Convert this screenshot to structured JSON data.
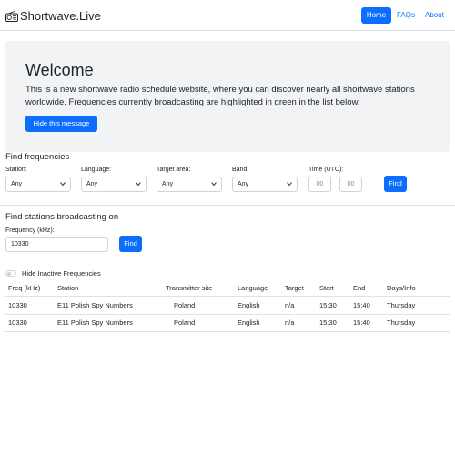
{
  "navbar": {
    "brand": "Shortwave.Live",
    "brand_icon": "radio-icon",
    "links": [
      "Home",
      "FAQs",
      "About"
    ],
    "active": "Home",
    "accent": "#0d6efd"
  },
  "hero": {
    "title": "Welcome",
    "text": "This is a new shortwave radio schedule website, where you can discover nearly all shortwave stations worldwide. Frequencies currently broadcasting are highlighted in green in the list below.",
    "button": "Hide this message"
  },
  "find_frequencies": {
    "title": "Find frequencies",
    "station": {
      "label": "Station:",
      "value": "Any"
    },
    "language": {
      "label": "Language:",
      "value": "Any"
    },
    "target_area": {
      "label": "Target area:",
      "value": "Any"
    },
    "band": {
      "label": "Band:",
      "value": "Any"
    },
    "time": {
      "label": "Time (UTC):",
      "hour_placeholder": "00",
      "minute_placeholder": "00"
    },
    "button": "Find"
  },
  "find_stations": {
    "title": "Find stations broadcasting on",
    "frequency_label": "Frequency (kHz):",
    "frequency_value": "10330",
    "button": "Find"
  },
  "toggle": {
    "label": "Hide Inactive Frequencies",
    "checked": false
  },
  "table": {
    "columns": [
      "Freq (kHz)",
      "Station",
      "Transmitter site",
      "Language",
      "Target",
      "Start",
      "End",
      "Days/Info"
    ],
    "rows": [
      [
        "10330",
        "E11 Polish Spy Numbers",
        "Poland",
        "English",
        "n/a",
        "15:30",
        "15:40",
        "Thursday"
      ],
      [
        "10330",
        "E11 Polish Spy Numbers",
        "Poland",
        "English",
        "n/a",
        "15:30",
        "15:40",
        "Thursday"
      ]
    ]
  }
}
